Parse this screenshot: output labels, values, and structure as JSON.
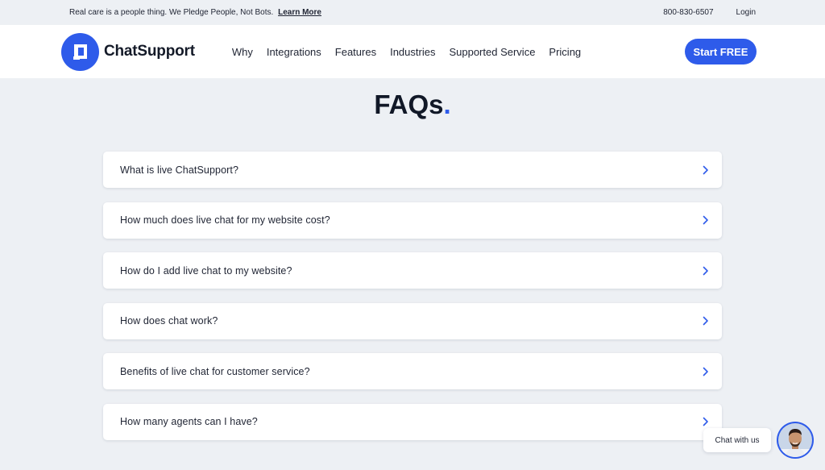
{
  "topbar": {
    "promo_text": "Real care is a people thing. We Pledge People, Not Bots.",
    "learn_more": "Learn More",
    "phone": "800-830-6507",
    "login": "Login"
  },
  "navbar": {
    "logo_text": "ChatSupport",
    "links": [
      "Why",
      "Integrations",
      "Features",
      "Industries",
      "Supported Service",
      "Pricing"
    ],
    "cta": "Start FREE"
  },
  "faq": {
    "title": "FAQs",
    "title_dot": ".",
    "questions": [
      "What is live ChatSupport?",
      "How much does live chat for my website cost?",
      "How do I add live chat to my website?",
      "How does chat work?",
      "Benefits of live chat for customer service?",
      "How many agents can I have?"
    ]
  },
  "chat_widget": {
    "label": "Chat with us"
  },
  "colors": {
    "brand": "#2e5bea",
    "background": "#edf0f4",
    "card": "#ffffff"
  }
}
